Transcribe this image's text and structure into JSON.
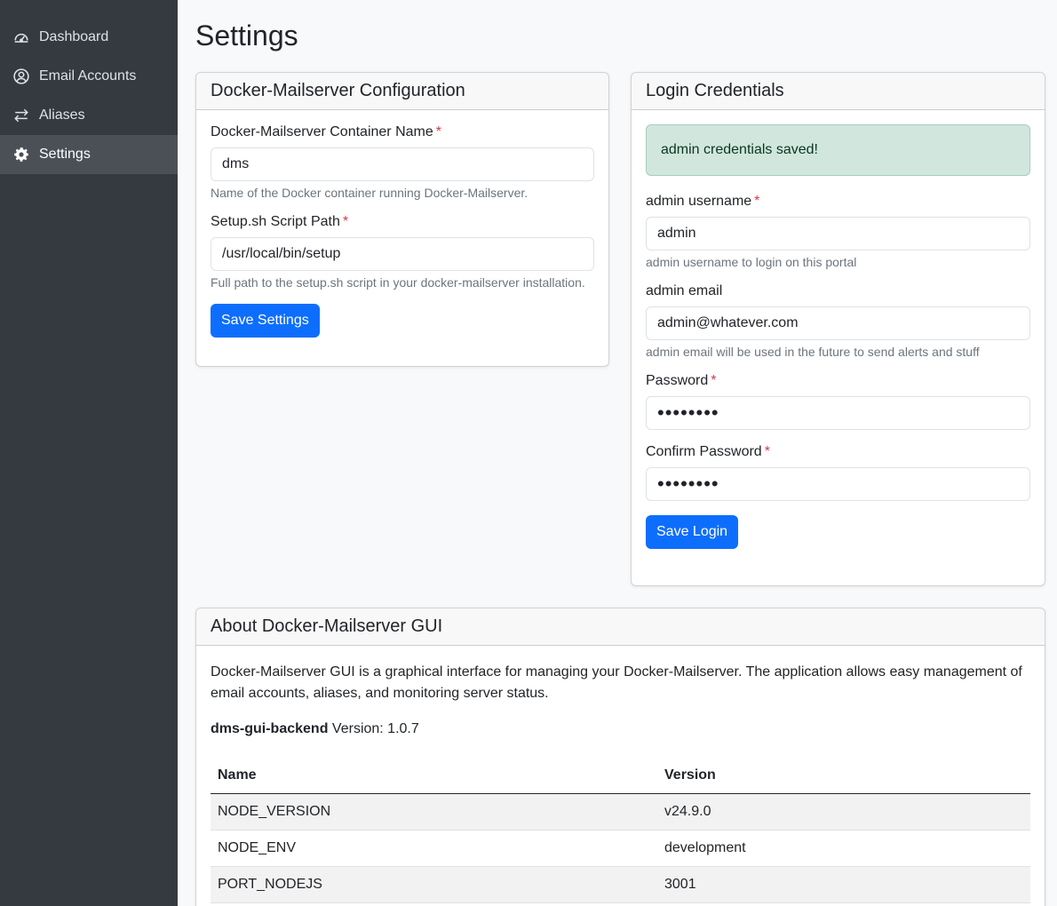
{
  "sidebar": {
    "items": [
      {
        "label": "Dashboard",
        "icon": "speedometer-icon"
      },
      {
        "label": "Email Accounts",
        "icon": "user-circle-icon"
      },
      {
        "label": "Aliases",
        "icon": "arrows-exchange-icon"
      },
      {
        "label": "Settings",
        "icon": "gear-icon",
        "active": true
      }
    ]
  },
  "page": {
    "title": "Settings"
  },
  "config_card": {
    "title": "Docker-Mailserver Configuration",
    "container_label": "Docker-Mailserver Container Name",
    "container_value": "dms",
    "container_help": "Name of the Docker container running Docker-Mailserver.",
    "script_label": "Setup.sh Script Path",
    "script_value": "/usr/local/bin/setup",
    "script_help": "Full path to the setup.sh script in your docker-mailserver installation.",
    "save_label": "Save Settings",
    "required_mark": "*"
  },
  "login_card": {
    "title": "Login Credentials",
    "alert": "admin credentials saved!",
    "username_label": "admin username",
    "username_value": "admin",
    "username_help": "admin username to login on this portal",
    "email_label": "admin email",
    "email_value": "admin@whatever.com",
    "email_help": "admin email will be used in the future to send alerts and stuff",
    "password_label": "Password",
    "password_value": "••••••••",
    "confirm_label": "Confirm Password",
    "confirm_value": "••••••••",
    "save_label": "Save Login",
    "required_mark": "*"
  },
  "about_card": {
    "title": "About Docker-Mailserver GUI",
    "description": "Docker-Mailserver GUI is a graphical interface for managing your Docker-Mailserver. The application allows easy management of email accounts, aliases, and monitoring server status.",
    "backend_name": "dms-gui-backend",
    "backend_version_text": "Version: 1.0.7",
    "table": {
      "headers": [
        "Name",
        "Version"
      ],
      "rows": [
        [
          "NODE_VERSION",
          "v24.9.0"
        ],
        [
          "NODE_ENV",
          "development"
        ],
        [
          "PORT_NODEJS",
          "3001"
        ]
      ]
    }
  },
  "colors": {
    "sidebar_bg": "#343a40",
    "primary": "#0d6efd",
    "success_bg": "#d1e7dd",
    "required": "#dc3545"
  }
}
